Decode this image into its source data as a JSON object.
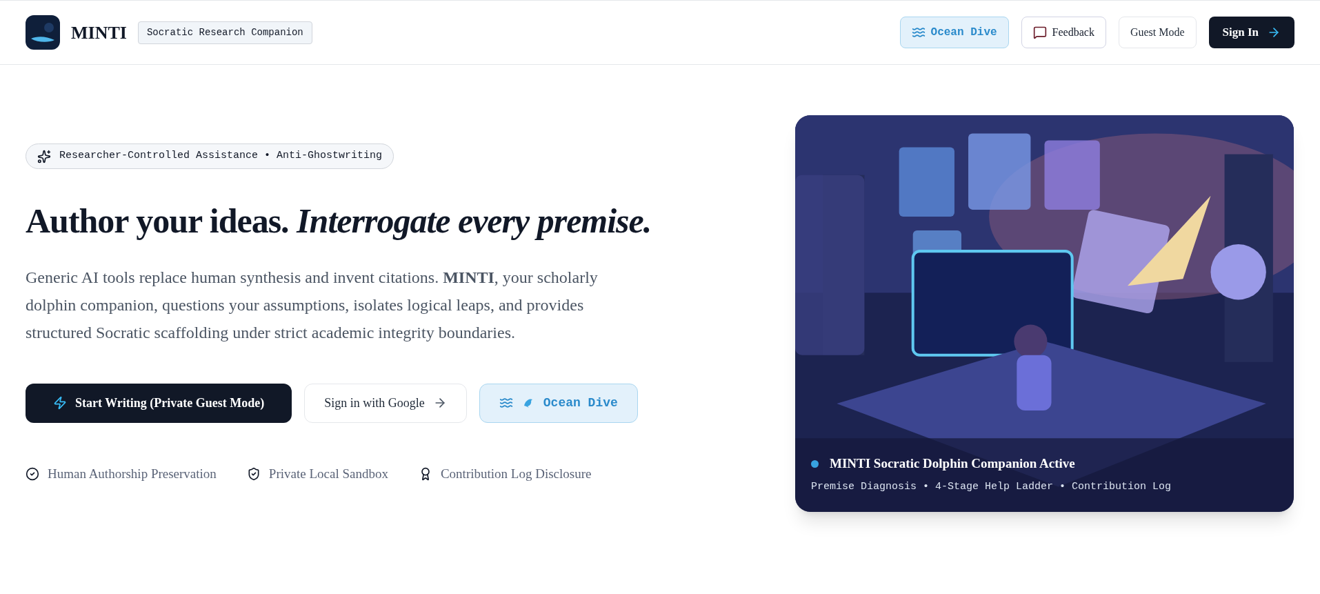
{
  "header": {
    "brand": "MINTI",
    "tagline": "Socratic Research Companion",
    "buttons": [
      {
        "kind": "ocean",
        "label": "Ocean Dive"
      },
      {
        "kind": "feedback",
        "label": "Feedback"
      },
      {
        "kind": "plain",
        "label": "Guest Mode"
      },
      {
        "kind": "primary",
        "label": "Sign In"
      }
    ]
  },
  "hero": {
    "badge": "Researcher-Controlled Assistance • Anti-Ghostwriting",
    "heading": "Author your ideas. *Interrogate every premise.*",
    "paragraph": "Generic AI tools replace human synthesis and invent citations. **MINTI**, your scholarly dolphin companion, questions your assumptions, isolates logical leaps, and provides structured Socratic scaffolding under strict academic integrity boundaries.",
    "actions": [
      {
        "kind": "primary",
        "label": "Start Writing (Private Guest Mode)"
      },
      {
        "kind": "google",
        "label": "Sign in with Google"
      },
      {
        "kind": "ocean",
        "label": "Ocean Dive"
      }
    ],
    "features": [
      {
        "kind": "check",
        "label": "Human Authorship Preservation"
      },
      {
        "kind": "shield",
        "label": "Private Local Sandbox"
      },
      {
        "kind": "award",
        "label": "Contribution Log Disclosure"
      }
    ],
    "image_card": {
      "kind": "picture",
      "color": "#38a3e0",
      "title": "MINTI Socratic Dolphin Companion Active",
      "subtitle": "Premise Diagnosis • 4-Stage Help Ladder • Contribution Log"
    }
  }
}
